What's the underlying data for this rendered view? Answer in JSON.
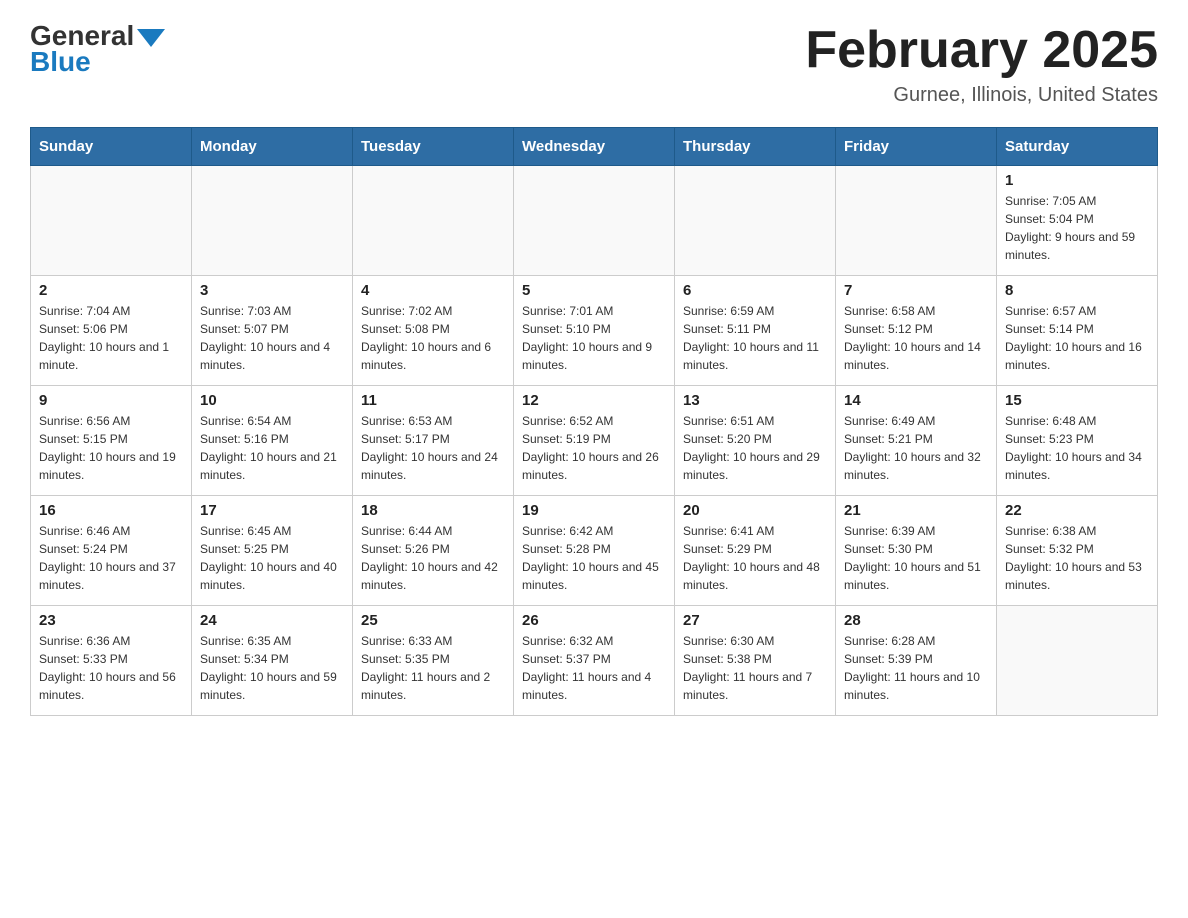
{
  "header": {
    "logo_general": "General",
    "logo_blue": "Blue",
    "month_title": "February 2025",
    "location": "Gurnee, Illinois, United States"
  },
  "weekdays": [
    "Sunday",
    "Monday",
    "Tuesday",
    "Wednesday",
    "Thursday",
    "Friday",
    "Saturday"
  ],
  "weeks": [
    [
      {
        "day": "",
        "info": ""
      },
      {
        "day": "",
        "info": ""
      },
      {
        "day": "",
        "info": ""
      },
      {
        "day": "",
        "info": ""
      },
      {
        "day": "",
        "info": ""
      },
      {
        "day": "",
        "info": ""
      },
      {
        "day": "1",
        "info": "Sunrise: 7:05 AM\nSunset: 5:04 PM\nDaylight: 9 hours and 59 minutes."
      }
    ],
    [
      {
        "day": "2",
        "info": "Sunrise: 7:04 AM\nSunset: 5:06 PM\nDaylight: 10 hours and 1 minute."
      },
      {
        "day": "3",
        "info": "Sunrise: 7:03 AM\nSunset: 5:07 PM\nDaylight: 10 hours and 4 minutes."
      },
      {
        "day": "4",
        "info": "Sunrise: 7:02 AM\nSunset: 5:08 PM\nDaylight: 10 hours and 6 minutes."
      },
      {
        "day": "5",
        "info": "Sunrise: 7:01 AM\nSunset: 5:10 PM\nDaylight: 10 hours and 9 minutes."
      },
      {
        "day": "6",
        "info": "Sunrise: 6:59 AM\nSunset: 5:11 PM\nDaylight: 10 hours and 11 minutes."
      },
      {
        "day": "7",
        "info": "Sunrise: 6:58 AM\nSunset: 5:12 PM\nDaylight: 10 hours and 14 minutes."
      },
      {
        "day": "8",
        "info": "Sunrise: 6:57 AM\nSunset: 5:14 PM\nDaylight: 10 hours and 16 minutes."
      }
    ],
    [
      {
        "day": "9",
        "info": "Sunrise: 6:56 AM\nSunset: 5:15 PM\nDaylight: 10 hours and 19 minutes."
      },
      {
        "day": "10",
        "info": "Sunrise: 6:54 AM\nSunset: 5:16 PM\nDaylight: 10 hours and 21 minutes."
      },
      {
        "day": "11",
        "info": "Sunrise: 6:53 AM\nSunset: 5:17 PM\nDaylight: 10 hours and 24 minutes."
      },
      {
        "day": "12",
        "info": "Sunrise: 6:52 AM\nSunset: 5:19 PM\nDaylight: 10 hours and 26 minutes."
      },
      {
        "day": "13",
        "info": "Sunrise: 6:51 AM\nSunset: 5:20 PM\nDaylight: 10 hours and 29 minutes."
      },
      {
        "day": "14",
        "info": "Sunrise: 6:49 AM\nSunset: 5:21 PM\nDaylight: 10 hours and 32 minutes."
      },
      {
        "day": "15",
        "info": "Sunrise: 6:48 AM\nSunset: 5:23 PM\nDaylight: 10 hours and 34 minutes."
      }
    ],
    [
      {
        "day": "16",
        "info": "Sunrise: 6:46 AM\nSunset: 5:24 PM\nDaylight: 10 hours and 37 minutes."
      },
      {
        "day": "17",
        "info": "Sunrise: 6:45 AM\nSunset: 5:25 PM\nDaylight: 10 hours and 40 minutes."
      },
      {
        "day": "18",
        "info": "Sunrise: 6:44 AM\nSunset: 5:26 PM\nDaylight: 10 hours and 42 minutes."
      },
      {
        "day": "19",
        "info": "Sunrise: 6:42 AM\nSunset: 5:28 PM\nDaylight: 10 hours and 45 minutes."
      },
      {
        "day": "20",
        "info": "Sunrise: 6:41 AM\nSunset: 5:29 PM\nDaylight: 10 hours and 48 minutes."
      },
      {
        "day": "21",
        "info": "Sunrise: 6:39 AM\nSunset: 5:30 PM\nDaylight: 10 hours and 51 minutes."
      },
      {
        "day": "22",
        "info": "Sunrise: 6:38 AM\nSunset: 5:32 PM\nDaylight: 10 hours and 53 minutes."
      }
    ],
    [
      {
        "day": "23",
        "info": "Sunrise: 6:36 AM\nSunset: 5:33 PM\nDaylight: 10 hours and 56 minutes."
      },
      {
        "day": "24",
        "info": "Sunrise: 6:35 AM\nSunset: 5:34 PM\nDaylight: 10 hours and 59 minutes."
      },
      {
        "day": "25",
        "info": "Sunrise: 6:33 AM\nSunset: 5:35 PM\nDaylight: 11 hours and 2 minutes."
      },
      {
        "day": "26",
        "info": "Sunrise: 6:32 AM\nSunset: 5:37 PM\nDaylight: 11 hours and 4 minutes."
      },
      {
        "day": "27",
        "info": "Sunrise: 6:30 AM\nSunset: 5:38 PM\nDaylight: 11 hours and 7 minutes."
      },
      {
        "day": "28",
        "info": "Sunrise: 6:28 AM\nSunset: 5:39 PM\nDaylight: 11 hours and 10 minutes."
      },
      {
        "day": "",
        "info": ""
      }
    ]
  ]
}
